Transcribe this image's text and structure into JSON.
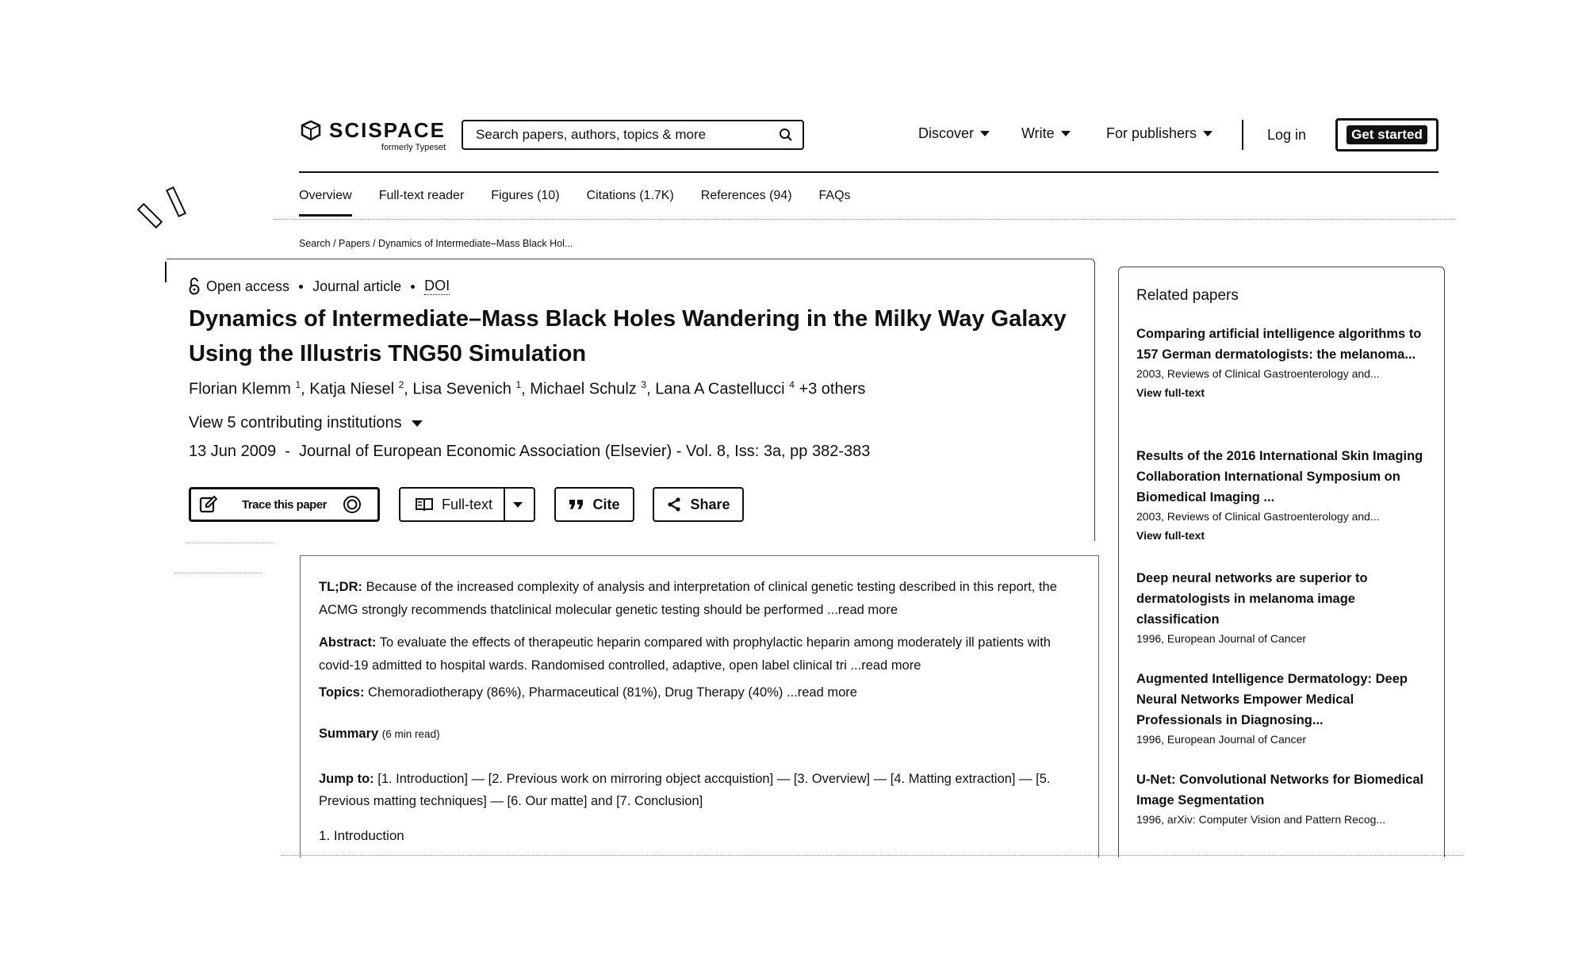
{
  "header": {
    "logo_name": "SCISPACE",
    "logo_sub": "formerly Typeset",
    "search_placeholder": "Search papers, authors, topics & more",
    "nav": [
      {
        "label": "Discover"
      },
      {
        "label": "Write"
      },
      {
        "label": "For publishers"
      }
    ],
    "login": "Log in",
    "get_started": "Get started"
  },
  "tabs": [
    {
      "label": "Overview",
      "active": true
    },
    {
      "label": "Full-text reader"
    },
    {
      "label": "Figures (10)"
    },
    {
      "label": "Citations (1.7K)"
    },
    {
      "label": "References (94)"
    },
    {
      "label": "FAQs"
    }
  ],
  "breadcrumb": "Search / Papers / Dynamics of Intermediate–Mass Black Hol...",
  "paper": {
    "access": "Open access",
    "type": "Journal article",
    "doi": "DOI",
    "title": "Dynamics of Intermediate–Mass Black Holes Wandering in the Milky Way Galaxy Using the Illustris TNG50 Simulation",
    "authors": [
      {
        "name": "Florian Klemm",
        "sup": "1"
      },
      {
        "name": "Katja Niesel",
        "sup": "2"
      },
      {
        "name": "Lisa Sevenich",
        "sup": "1"
      },
      {
        "name": "Michael Schulz",
        "sup": "3"
      },
      {
        "name": "Lana A Castellucci",
        "sup": "4"
      }
    ],
    "others": "+3 others",
    "institutions": "View 5 contributing institutions",
    "pubinfo": "13 Jun 2009  -  Journal of European Economic Association (Elsevier) - Vol. 8, Iss: 3a, pp 382-383"
  },
  "actions": {
    "trace": "Trace this paper",
    "fulltext": "Full-text",
    "cite": "Cite",
    "share": "Share"
  },
  "detail": {
    "tldr_label": "TL;DR:",
    "tldr_text": " Because of the increased complexity of analysis and interpretation of clinical genetic testing described in this report, the ACMG strongly recommends thatclinical molecular genetic testing should be performed ",
    "abstract_label": "Abstract:",
    "abstract_text": " To evaluate the effects of therapeutic heparin compared with prophylactic heparin among moderately ill patients with covid-19 admitted to hospital wards. Randomised controlled, adaptive, open label clinical tri ",
    "read_more": "...read more",
    "topics_label": "Topics:",
    "topics_text": " Chemoradiotherapy (86%), Pharmaceutical (81%), Drug Therapy (40%) ",
    "summary_label": "Summary",
    "summary_time": "(6 min read)",
    "jump_label": "Jump to:",
    "jump_text": " [1. Introduction] — [2. Previous work on mirroring object accquistion] — [3. Overview] — [4. Matting extraction] — [5. Previous matting techniques] — [6. Our matte] and [7. Conclusion]",
    "intro": "1. Introduction"
  },
  "related": {
    "title": "Related papers",
    "view_full_text": "View full-text",
    "items": [
      {
        "title": "Comparing artificial intelligence algorithms to 157 German dermatologists: the melanoma...",
        "meta": "2003, Reviews of Clinical Gastroenterology and..."
      },
      {
        "title": "Results of the 2016 International Skin Imaging Collaboration International Symposium on Biomedical Imaging ...",
        "meta": "2003, Reviews of Clinical Gastroenterology and..."
      },
      {
        "title": "Deep neural networks are superior to dermatologists in melanoma image classification",
        "meta": "1996, European Journal of Cancer"
      },
      {
        "title": "Augmented Intelligence Dermatology: Deep Neural Networks Empower Medical Professionals in Diagnosing...",
        "meta": "1996, European Journal of Cancer"
      },
      {
        "title": "U-Net: Convolutional Networks for Biomedical Image Segmentation",
        "meta": "1996, arXiv: Computer Vision and Pattern Recog..."
      }
    ]
  }
}
